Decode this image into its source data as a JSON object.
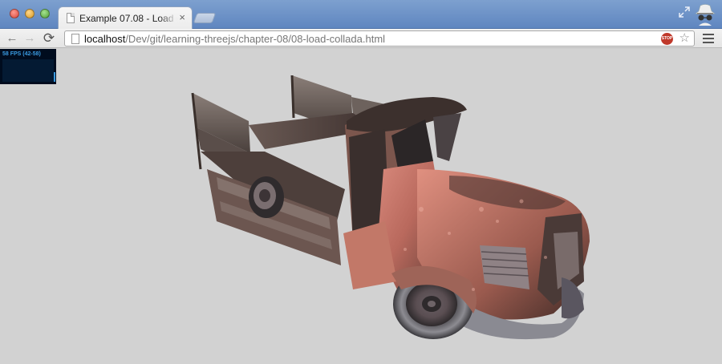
{
  "window": {
    "tab_title": "Example 07.08 - Load collada",
    "tab_close": "×"
  },
  "toolbar": {
    "back": "←",
    "forward": "→",
    "reload": "⟳",
    "url_host": "localhost",
    "url_path": "/Dev/git/learning-threejs/chapter-08/08-load-collada.html",
    "stop_badge": "STOP",
    "star": "☆"
  },
  "stats": {
    "fps_label": "58 FPS (42-58)"
  },
  "colors": {
    "titlebar": "#6f93c8",
    "viewport_bg": "#d2d2d2",
    "stats_bg": "#000c1e",
    "stats_fg": "#3a9ae0",
    "truck_body": "#c9766a"
  },
  "icons": {
    "page": "document-icon",
    "fullscreen": "fullscreen-icon",
    "profile": "incognito-icon",
    "menu": "hamburger-menu-icon"
  }
}
